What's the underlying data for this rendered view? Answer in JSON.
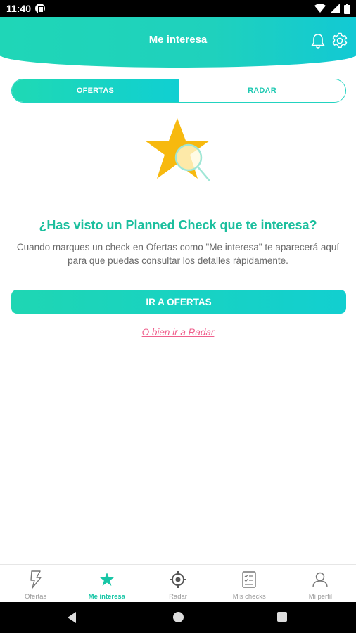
{
  "status_bar": {
    "time": "11:40"
  },
  "header": {
    "title": "Me interesa"
  },
  "tabs": [
    {
      "label": "OFERTAS",
      "active": true
    },
    {
      "label": "RADAR",
      "active": false
    }
  ],
  "empty_state": {
    "headline": "¿Has visto un Planned Check que te interesa?",
    "description": "Cuando marques un check en Ofertas como \"Me interesa\" te aparecerá aquí para que puedas consultar los detalles rápidamente.",
    "cta_label": "IR A OFERTAS",
    "alt_link": "O bien ir a Radar"
  },
  "bottom_nav": {
    "items": [
      {
        "label": "Ofertas",
        "icon": "lightning-icon",
        "active": false
      },
      {
        "label": "Me interesa",
        "icon": "star-icon",
        "active": true
      },
      {
        "label": "Radar",
        "icon": "radar-icon",
        "active": false
      },
      {
        "label": "Mis checks",
        "icon": "checklist-icon",
        "active": false
      },
      {
        "label": "Mi perfil",
        "icon": "profile-icon",
        "active": false
      }
    ]
  },
  "colors": {
    "accent": "#1fd6b7",
    "headline": "#1cbf9e",
    "link": "#ef5f8c",
    "star": "#f7b90f"
  }
}
